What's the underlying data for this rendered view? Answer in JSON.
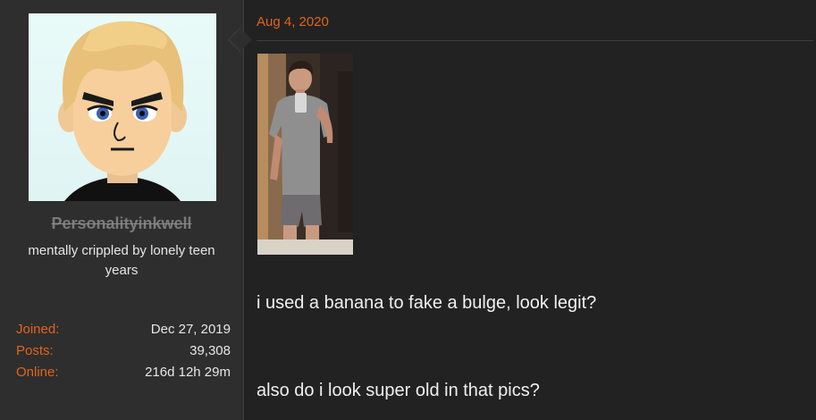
{
  "user": {
    "username": "Personalityinkwell",
    "title": "mentally crippled by lonely teen years",
    "avatar_icon": "mii-avatar",
    "stats": [
      {
        "label": "Joined:",
        "value": "Dec 27, 2019"
      },
      {
        "label": "Posts:",
        "value": "39,308"
      },
      {
        "label": "Online:",
        "value": "216d 12h 29m"
      }
    ]
  },
  "post": {
    "date": "Aug 4, 2020",
    "image_subject": "mirror-selfie-photo",
    "lines": [
      "i used a banana to fake a bulge, look legit?",
      "also do i look super old in that pics?"
    ]
  },
  "colors": {
    "accent": "#e1641c",
    "panel_bg": "#2e2e2e",
    "body_bg": "#222222",
    "text": "#f0f0f0"
  }
}
